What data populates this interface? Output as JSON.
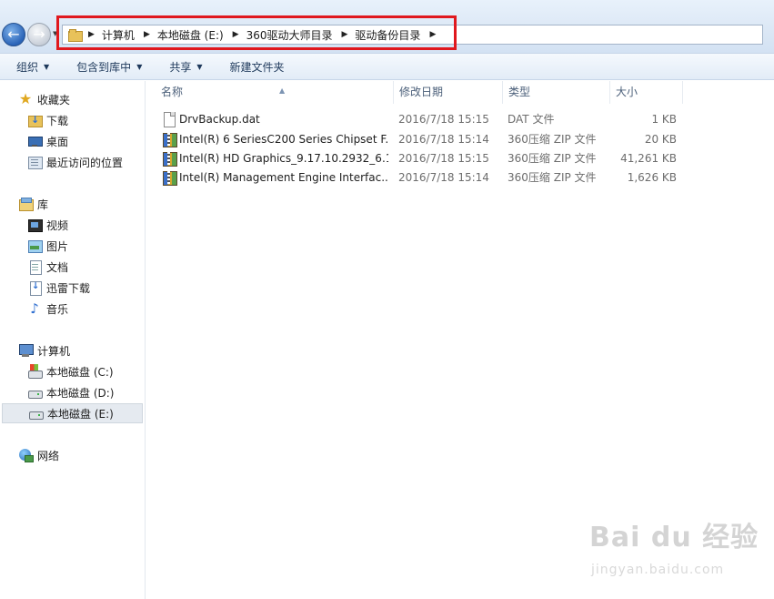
{
  "nav": {
    "back_icon": "back-arrow-icon",
    "forward_icon": "forward-arrow-icon"
  },
  "breadcrumb": [
    "计算机",
    "本地磁盘 (E:)",
    "360驱动大师目录",
    "驱动备份目录"
  ],
  "toolbar": {
    "organize": "组织",
    "include_in_library": "包含到库中",
    "share": "共享",
    "new_folder": "新建文件夹"
  },
  "sidebar": {
    "favorites": "收藏夹",
    "downloads": "下载",
    "desktop": "桌面",
    "recent": "最近访问的位置",
    "libraries": "库",
    "videos": "视频",
    "pictures": "图片",
    "documents": "文档",
    "xunlei": "迅雷下载",
    "music": "音乐",
    "computer": "计算机",
    "drive_c": "本地磁盘 (C:)",
    "drive_d": "本地磁盘 (D:)",
    "drive_e": "本地磁盘 (E:)",
    "network": "网络"
  },
  "columns": {
    "name": "名称",
    "modified": "修改日期",
    "type": "类型",
    "size": "大小"
  },
  "files": [
    {
      "name": "DrvBackup.dat",
      "modified": "2016/7/18 15:15",
      "type": "DAT 文件",
      "size": "1 KB",
      "icon": "dat-file-icon"
    },
    {
      "name": "Intel(R) 6 SeriesC200 Series Chipset F...",
      "modified": "2016/7/18 15:14",
      "type": "360压缩 ZIP 文件",
      "size": "20 KB",
      "icon": "zip-file-icon"
    },
    {
      "name": "Intel(R) HD Graphics_9.17.10.2932_6.1...",
      "modified": "2016/7/18 15:15",
      "type": "360压缩 ZIP 文件",
      "size": "41,261 KB",
      "icon": "zip-file-icon"
    },
    {
      "name": "Intel(R) Management Engine Interfac...",
      "modified": "2016/7/18 15:14",
      "type": "360压缩 ZIP 文件",
      "size": "1,626 KB",
      "icon": "zip-file-icon"
    }
  ],
  "watermark": {
    "brand": "Bai du 经验",
    "url": "jingyan.baidu.com"
  },
  "colors": {
    "highlight_box": "#e0181e",
    "toolbar_text": "#1e395b"
  }
}
